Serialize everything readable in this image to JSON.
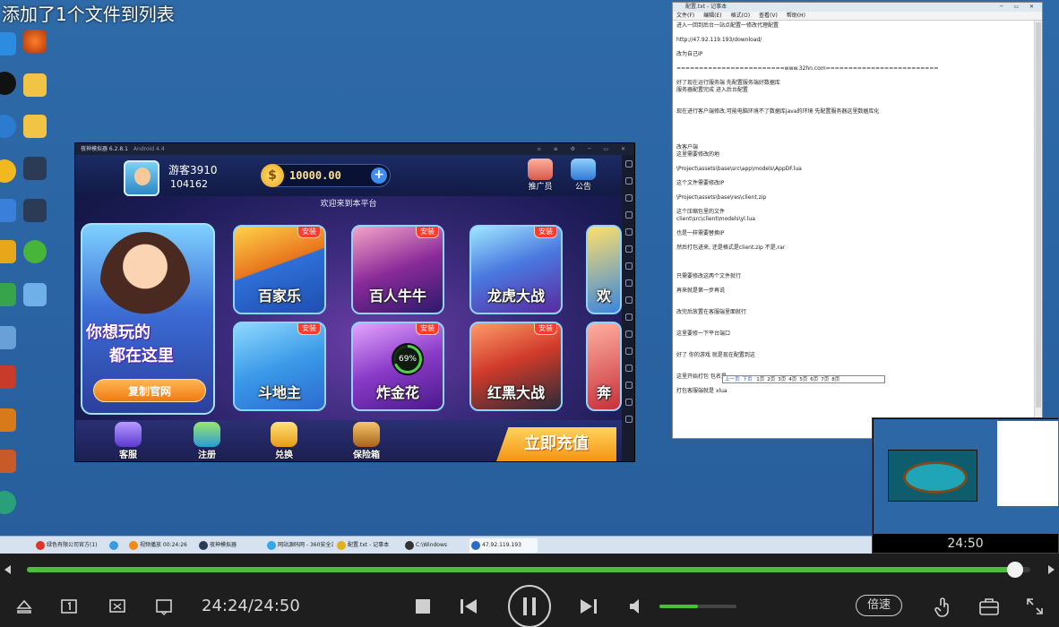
{
  "toast": "添加了1个文件到列表",
  "emulator": {
    "title": "夜神模拟器 6.2.8.1",
    "version_tag": "Android 4.4"
  },
  "game": {
    "username": "游客3910",
    "user_id": "104162",
    "coins": "10000.00",
    "promoter_label": "推广员",
    "notice_label": "公告",
    "welcome": "欢迎来到本平台",
    "promo_line1": "你想玩的",
    "promo_line2": "都在这里",
    "copy_url_button": "复制官网",
    "install_badge": "安装",
    "loading_percent": "69%",
    "tiles": [
      "百家乐",
      "百人牛牛",
      "龙虎大战",
      "欢",
      "斗地主",
      "炸金花",
      "红黑大战",
      "奔"
    ],
    "bottom": {
      "service": "客服",
      "register": "注册",
      "exchange": "兑换",
      "safe": "保险箱",
      "recharge": "立即充值"
    }
  },
  "notepad": {
    "title": "配置.txt - 记事本",
    "menu": [
      "文件(F)",
      "编辑(E)",
      "格式(O)",
      "查看(V)",
      "帮助(H)"
    ],
    "lines": [
      "进入一回到后台一站点配置一修改代理配置",
      "",
      "http://47.92.119.193/download/",
      "",
      "改为自己IP",
      "",
      "========================www.32hn.com=========================",
      "",
      "好了现在运行服务端 先配置服务端好数据库",
      "服务器配置完成 进入后台配置",
      "",
      "",
      "现在进行客户端修改,可能电脑环境不了数据库java的环境 先配置服务器这里数据库化",
      "",
      "",
      "",
      "",
      "改客户端",
      "这里需要修改的地",
      "",
      "\\Project\\assets\\base\\src\\app\\models\\AppDF.lua",
      "",
      "这个文件需要修改IP",
      "",
      "\\Project\\assets\\base\\res\\client.zip",
      "",
      "这个压缩包里的文件",
      "client\\src\\client\\models\\yl.lua",
      "",
      "也是一样需要替换IP",
      "",
      "然后打包进来,  还是格式是client.zip 不是.rar",
      "",
      "",
      "",
      "只需要修改这两个文件就行",
      "",
      "再来就是第一步再说",
      "",
      "",
      "改完后放置在客服端里面就行",
      "",
      "",
      "这里要修一下平台端口",
      "",
      "",
      "好了 你的游戏  就是现在配置到这",
      "",
      "",
      "这里开始打包  包名是",
      "",
      "打包客服端就是  xlua"
    ],
    "pager": {
      "up": "上一页",
      "prev": "下页",
      "pages": [
        "1页",
        "2页",
        "3页",
        "4页",
        "5页",
        "6页",
        "7页",
        "8页"
      ]
    }
  },
  "pip": {
    "time": "24:50"
  },
  "taskbar": [
    {
      "label": "绿色有限公司官方(1)",
      "color": "#e0342a"
    },
    {
      "label": "",
      "color": "#3b9be0"
    },
    {
      "label": "视频播放 00:24:26",
      "color": "#f08a16"
    },
    {
      "label": "夜神模拟器",
      "color": "#2b3a55"
    },
    {
      "label": "网站源码网 - 360安全浏览器",
      "color": "#35a6e8"
    },
    {
      "label": "配置.txt - 记事本",
      "color": "#e0b21a"
    },
    {
      "label": "C:\\Windows",
      "color": "#333333"
    },
    {
      "label": "47.92.119.193",
      "color": "#2a6ac8"
    }
  ],
  "player": {
    "current_time": "24:24",
    "total_time": "24:50",
    "progress": 0.985,
    "volume": 0.5,
    "speed_label": "倍速",
    "accent": "#4cbf3a"
  }
}
